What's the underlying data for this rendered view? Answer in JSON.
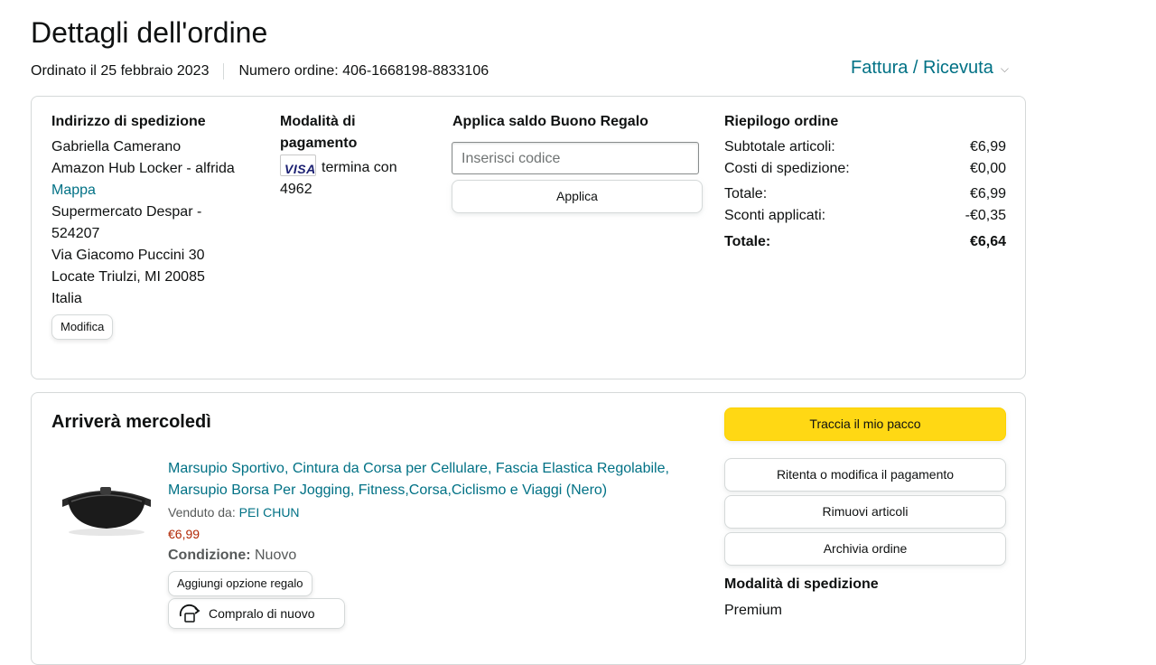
{
  "page": {
    "title": "Dettagli dell'ordine",
    "order_date": "Ordinato il 25 febbraio 2023",
    "order_number": "Numero ordine: 406-1668198-8833106",
    "invoice_link": "Fattura / Ricevuta"
  },
  "shipping": {
    "heading": "Indirizzo di spedizione",
    "name": "Gabriella Camerano",
    "locker": "Amazon Hub Locker - alfrida",
    "map_link": "Mappa",
    "line1": "Supermercato Despar -",
    "line2": "524207",
    "street": "Via Giacomo Puccini 30",
    "city": "Locate Triulzi, MI 20085",
    "country": "Italia",
    "edit_button": "Modifica"
  },
  "payment": {
    "heading_line1": "Modalità di",
    "heading_line2": "pagamento",
    "card_brand": "VISA",
    "ends_with": "termina con",
    "last_digits": "4962"
  },
  "gift_card": {
    "heading": "Applica saldo Buono Regalo",
    "placeholder": "Inserisci codice",
    "apply_button": "Applica"
  },
  "summary": {
    "heading": "Riepilogo ordine",
    "rows": [
      {
        "label": "Subtotale articoli:",
        "value": "€6,99"
      },
      {
        "label": "Costi di spedizione:",
        "value": "€0,00"
      },
      {
        "label": "Totale:",
        "value": "€6,99"
      },
      {
        "label": "Sconti applicati:",
        "value": "-€0,35"
      }
    ],
    "grand_total_label": "Totale:",
    "grand_total_value": "€6,64"
  },
  "shipment": {
    "heading": "Arriverà mercoledì",
    "product_title": "Marsupio Sportivo, Cintura da Corsa per Cellulare, Fascia Elastica Regolabile, Marsupio Borsa Per Jogging, Fitness,Corsa,Ciclismo e Viaggi (Nero)",
    "sold_by_label": "Venduto da:",
    "seller": "PEI CHUN",
    "price": "€6,99",
    "condition_label": "Condizione:",
    "condition_value": "Nuovo",
    "gift_button": "Aggiungi opzione regalo",
    "buy_again_button": "Compralo di nuovo",
    "track_button": "Traccia il mio pacco",
    "retry_payment_button": "Ritenta o modifica il pagamento",
    "remove_items_button": "Rimuovi articoli",
    "archive_button": "Archivia ordine",
    "shipping_method_heading": "Modalità di spedizione",
    "shipping_method": "Premium"
  }
}
